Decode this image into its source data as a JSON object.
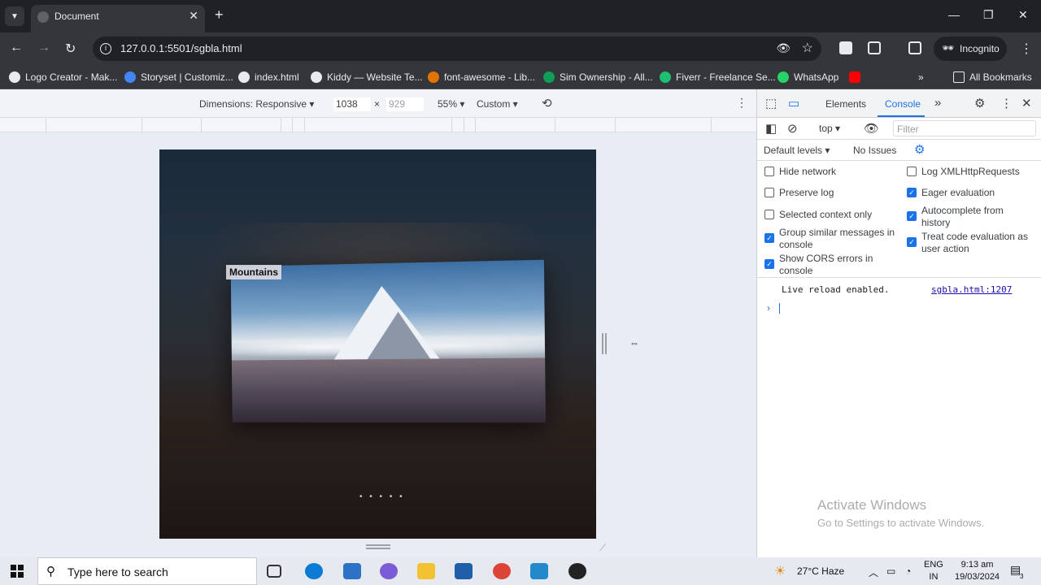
{
  "browser": {
    "tab_title": "Document",
    "url": "127.0.0.1:5501/sgbla.html",
    "incognito_label": "Incognito"
  },
  "bookmarks": [
    {
      "label": "Logo Creator - Mak...",
      "color": "#e8eaed"
    },
    {
      "label": "Storyset | Customiz...",
      "color": "#4285f4"
    },
    {
      "label": "index.html",
      "color": "#e8eaed"
    },
    {
      "label": "Kiddy — Website Te...",
      "color": "#e8eaed"
    },
    {
      "label": "font-awesome - Lib...",
      "color": "#e37400"
    },
    {
      "label": "Sim Ownership - All...",
      "color": "#0f9d58"
    },
    {
      "label": "Fiverr - Freelance Se...",
      "color": "#1dbf73"
    },
    {
      "label": "WhatsApp",
      "color": "#25d366"
    },
    {
      "label": "",
      "color": "#ff0000"
    }
  ],
  "all_bookmarks_label": "All Bookmarks",
  "device_toolbar": {
    "dimensions_label": "Dimensions: Responsive",
    "width": "1038",
    "height": "929",
    "times": "×",
    "zoom": "55%",
    "throttle": "Custom"
  },
  "preview": {
    "card_label": "Mountains",
    "dots": "• • • • •"
  },
  "devtools": {
    "tabs": [
      "Elements",
      "Console"
    ],
    "active_tab": "Console",
    "context": "top",
    "filter_placeholder": "Filter",
    "levels": "Default levels",
    "issues": "No Issues",
    "options_left": [
      {
        "label": "Hide network",
        "checked": false
      },
      {
        "label": "Preserve log",
        "checked": false
      },
      {
        "label": "Selected context only",
        "checked": false
      },
      {
        "label": "Group similar messages in console",
        "checked": true
      },
      {
        "label": "Show CORS errors in console",
        "checked": true
      }
    ],
    "options_right": [
      {
        "label": "Log XMLHttpRequests",
        "checked": false
      },
      {
        "label": "Eager evaluation",
        "checked": true
      },
      {
        "label": "Autocomplete from history",
        "checked": true
      },
      {
        "label": "Treat code evaluation as user action",
        "checked": true
      }
    ],
    "log_message": "Live reload enabled.",
    "log_source": "sgbla.html:1207"
  },
  "watermark": {
    "line1": "Activate Windows",
    "line2": "Go to Settings to activate Windows."
  },
  "taskbar": {
    "search_placeholder": "Type here to search",
    "weather": "27°C  Haze",
    "language_top": "ENG",
    "language_bottom": "IN",
    "time": "9:13 am",
    "date": "19/03/2024",
    "notifications": "3"
  }
}
